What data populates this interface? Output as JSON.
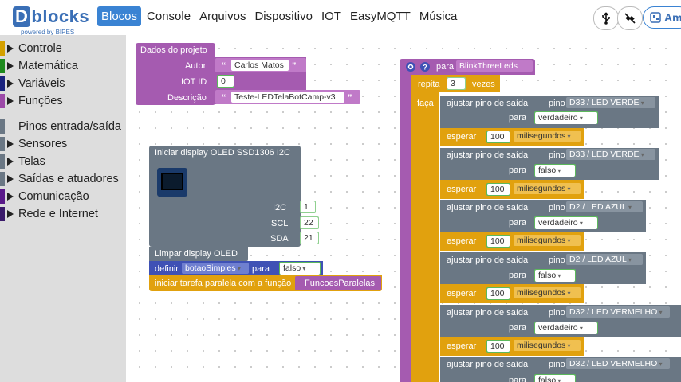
{
  "logo": {
    "letter": "D",
    "word": "blocks",
    "sub": "powered by BIPES"
  },
  "nav": [
    "Blocos",
    "Console",
    "Arquivos",
    "Dispositivo",
    "IOT",
    "EasyMQTT",
    "Música"
  ],
  "right_button": "Am",
  "sidebar": [
    {
      "label": "Controle",
      "color": "#d4a000",
      "arrow": true
    },
    {
      "label": "Matemática",
      "color": "#1e8a1e",
      "arrow": true
    },
    {
      "label": "Variáveis",
      "color": "#1a237e",
      "arrow": true
    },
    {
      "label": "Funções",
      "color": "#9c4aa8",
      "arrow": true
    },
    {
      "label": "Pinos entrada/saída",
      "color": "#6a7784",
      "arrow": false
    },
    {
      "label": "Sensores",
      "color": "#6a7784",
      "arrow": true
    },
    {
      "label": "Telas",
      "color": "#6a7784",
      "arrow": true
    },
    {
      "label": "Saídas e atuadores",
      "color": "#6a7784",
      "arrow": true
    },
    {
      "label": "Comunicação",
      "color": "#5a1a8a",
      "arrow": true
    },
    {
      "label": "Rede e Internet",
      "color": "#3a1a6a",
      "arrow": true
    }
  ],
  "project": {
    "title": "Dados do projeto",
    "author_label": "Autor",
    "author": "Carlos Matos",
    "iot_label": "IOT ID",
    "iot": "0",
    "desc_label": "Descrição",
    "desc": "Teste-LEDTelaBotCamp-v3"
  },
  "oled": {
    "title": "Iniciar display OLED SSD1306 I2C",
    "i2c_label": "I2C",
    "i2c": "1",
    "scl_label": "SCL",
    "scl": "22",
    "sda_label": "SDA",
    "sda": "21",
    "clear": "Limpar display OLED",
    "set_label": "definir",
    "var": "botaoSimples",
    "to_label": "para",
    "value": "falso",
    "task_label": "iniciar tarefa paralela com a função",
    "task_fn": "FuncoesParalelas"
  },
  "func": {
    "label": "para",
    "name": "BlinkThreeLeds",
    "repeat_label": "repita",
    "times": "3",
    "times_label": "vezes",
    "do_label": "faça"
  },
  "steps": [
    {
      "set_label": "ajustar pino de saída",
      "pin_label": "pino",
      "pin": "D33 / LED VERDE",
      "to_label": "para",
      "value": "verdadeiro",
      "wait_label": "esperar",
      "ms": "100",
      "unit": "milisegundos"
    },
    {
      "set_label": "ajustar pino de saída",
      "pin_label": "pino",
      "pin": "D33 / LED VERDE",
      "to_label": "para",
      "value": "falso",
      "wait_label": "esperar",
      "ms": "100",
      "unit": "milisegundos"
    },
    {
      "set_label": "ajustar pino de saída",
      "pin_label": "pino",
      "pin": "D2 / LED AZUL",
      "to_label": "para",
      "value": "verdadeiro",
      "wait_label": "esperar",
      "ms": "100",
      "unit": "milisegundos"
    },
    {
      "set_label": "ajustar pino de saída",
      "pin_label": "pino",
      "pin": "D2 / LED AZUL",
      "to_label": "para",
      "value": "falso",
      "wait_label": "esperar",
      "ms": "100",
      "unit": "milisegundos"
    },
    {
      "set_label": "ajustar pino de saída",
      "pin_label": "pino",
      "pin": "D32 / LED VERMELHO",
      "to_label": "para",
      "value": "verdadeiro",
      "wait_label": "esperar",
      "ms": "100",
      "unit": "milisegundos"
    },
    {
      "set_label": "ajustar pino de saída",
      "pin_label": "pino",
      "pin": "D32 / LED VERMELHO",
      "to_label": "para",
      "value": "falso",
      "wait_label": "",
      "ms": "",
      "unit": ""
    }
  ],
  "colors": {
    "project": "#a55bb0",
    "oled": "#6a7784",
    "var": "#3f51b5",
    "control": "#e1a10e",
    "green": "#5cb85c"
  }
}
